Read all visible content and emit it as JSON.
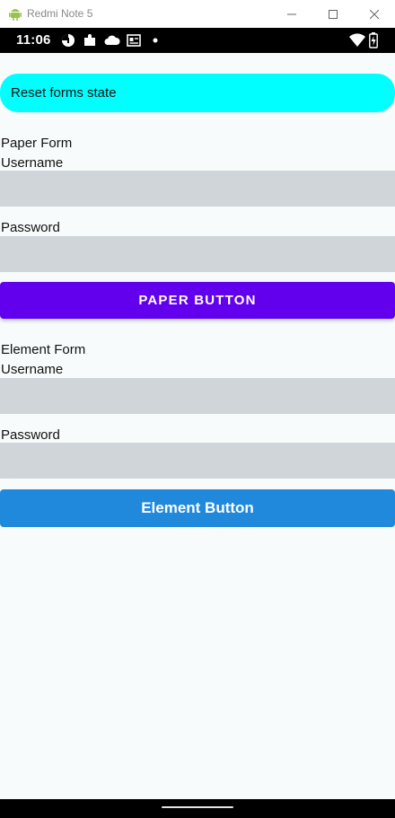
{
  "window": {
    "title": "Redmi Note 5"
  },
  "status_bar": {
    "time": "11:06"
  },
  "reset_button": {
    "label": "Reset forms state"
  },
  "paper_form": {
    "heading": "Paper Form",
    "username_label": "Username",
    "username_value": "",
    "password_label": "Password",
    "password_value": "",
    "button_label": "PAPER BUTTON"
  },
  "element_form": {
    "heading": "Element Form",
    "username_label": "Username",
    "username_value": "",
    "password_label": "Password",
    "password_value": "",
    "button_label": "Element Button"
  },
  "colors": {
    "reset": "#00ffff",
    "paper_button": "#6200ee",
    "element_button": "#2089dc",
    "input_bg": "#d0d5d9"
  }
}
